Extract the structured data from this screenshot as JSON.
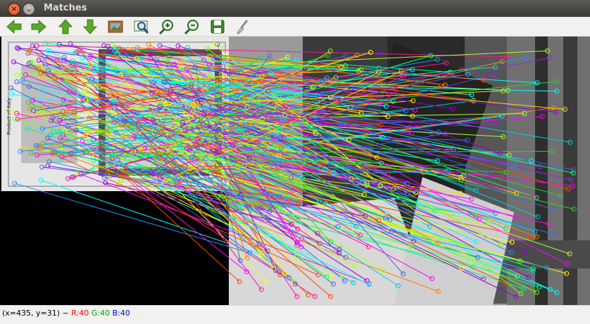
{
  "window": {
    "title": "Matches",
    "close_glyph": "×",
    "menu_glyph": "⌄"
  },
  "toolbar": {
    "tools": [
      {
        "name": "pan-left-icon"
      },
      {
        "name": "pan-right-icon"
      },
      {
        "name": "pan-up-icon"
      },
      {
        "name": "pan-down-icon"
      },
      {
        "name": "zoom-fit-image-icon"
      },
      {
        "name": "zoom-region-icon"
      },
      {
        "name": "zoom-in-icon"
      },
      {
        "name": "zoom-out-icon"
      },
      {
        "name": "save-icon"
      },
      {
        "name": "properties-brush-icon"
      }
    ]
  },
  "status": {
    "coords": "(x=435, y=31) ~ ",
    "r": "R:40",
    "g": "G:40",
    "b": "B:40"
  },
  "image": {
    "description_free": true,
    "box_text": "Product of Italy"
  }
}
